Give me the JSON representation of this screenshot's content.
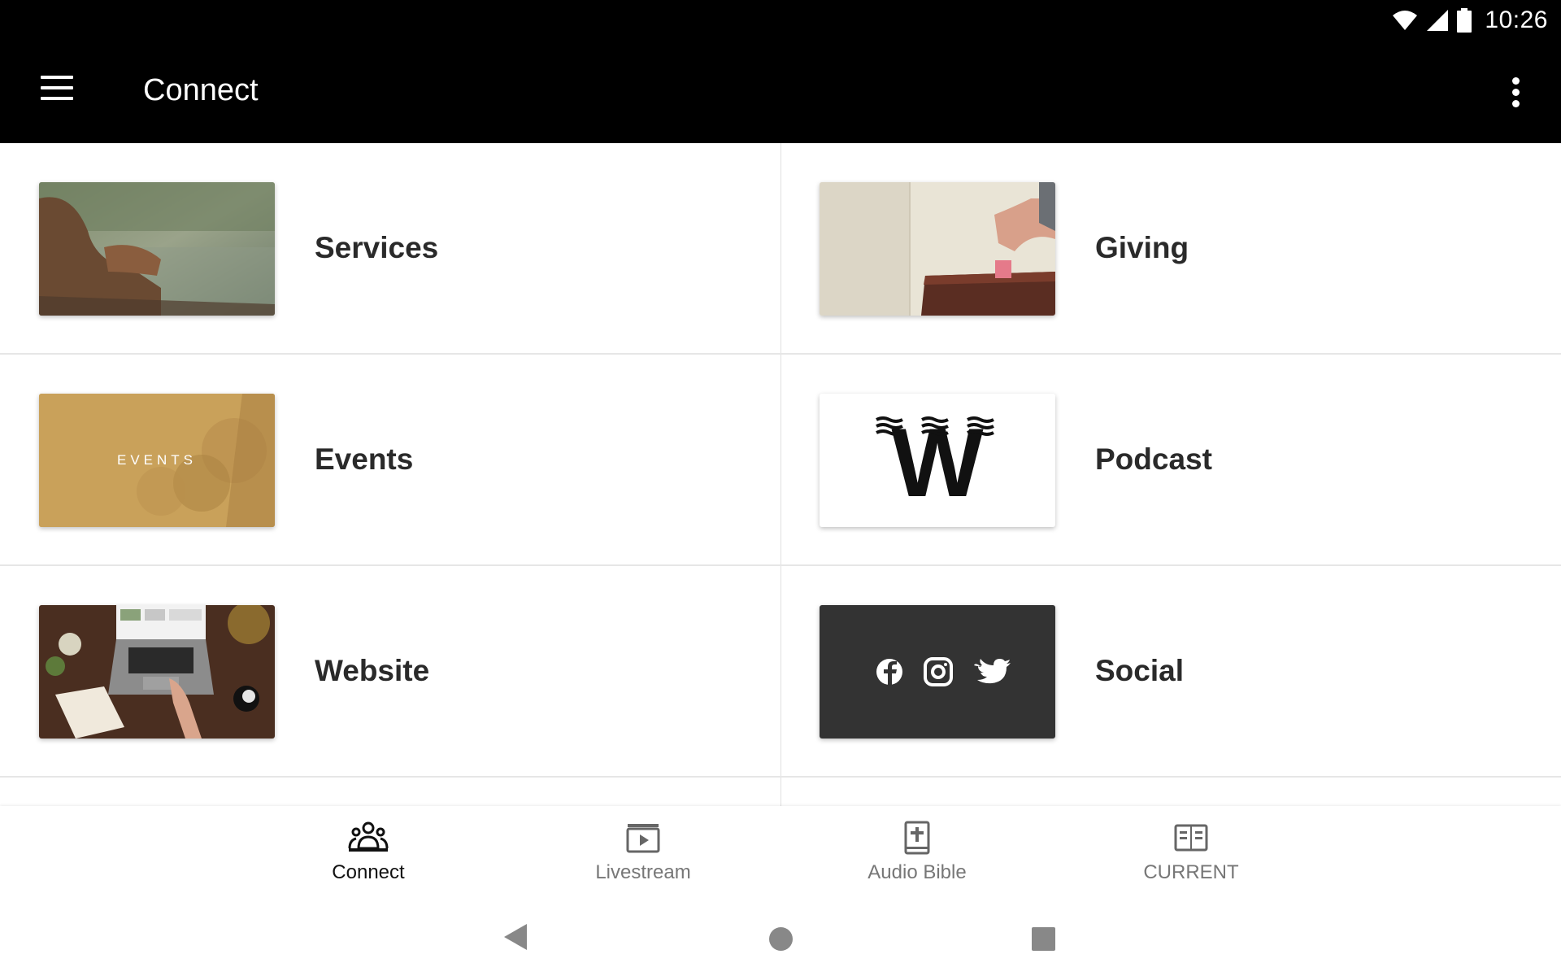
{
  "status_bar": {
    "time": "10:26"
  },
  "app_bar": {
    "title": "Connect"
  },
  "tiles": [
    {
      "label": "Services"
    },
    {
      "label": "Giving"
    },
    {
      "label": "Events",
      "thumb_text": "EVENTS"
    },
    {
      "label": "Podcast",
      "thumb_text": "W"
    },
    {
      "label": "Website"
    },
    {
      "label": "Social"
    }
  ],
  "bottom_nav": {
    "items": [
      {
        "label": "Connect",
        "icon": "people-icon",
        "active": true
      },
      {
        "label": "Livestream",
        "icon": "play-icon"
      },
      {
        "label": "Audio Bible",
        "icon": "bible-icon"
      },
      {
        "label": "CURRENT",
        "icon": "book-open-icon"
      }
    ]
  },
  "colors": {
    "appbar": "#000000",
    "social_tile": "#333333",
    "events_tile": "#c9a15a"
  }
}
